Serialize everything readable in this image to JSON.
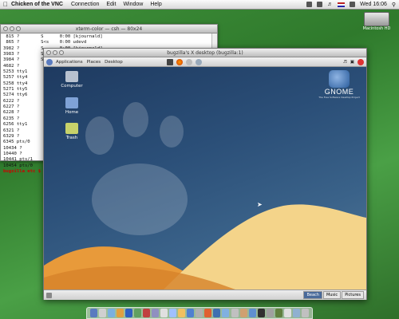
{
  "menubar": {
    "apple": "",
    "app_name": "Chicken of the VNC",
    "items": [
      "Connection",
      "Edit",
      "Window",
      "Help"
    ],
    "clock": "Wed 16:06"
  },
  "desktop_drive": {
    "label": "Macintosh HD"
  },
  "xterm": {
    "title": "xterm-color — csh — 80x24",
    "lines": [
      " 815 ?        S      0:00 [kjournald]",
      " 865 ?        S<s    0:00 udevd",
      "3982 ?        S      0:00 [kjournald]",
      "3983 ?        S      0:00 [kjournald]",
      "3984 ?        S      0:00 [kjournald]",
      "4682 ?",
      "5253 tty1",
      "5257 tty4",
      "5258 tty4",
      "5271 tty5",
      "5274 tty6",
      "6222 ?",
      "6227 ?",
      "6228 ?",
      "6235 ?",
      "6256 tty1",
      "6321 ?",
      "6329 ?",
      "6345 pts/0",
      "10434 ?",
      "10440 ?",
      "10441 pts/1",
      "10454 pts/0"
    ],
    "prompt": "bugzilla etc $"
  },
  "vnc": {
    "title": "bugzilla's X desktop (bugzilla:1)",
    "panel": {
      "applications": "Applications",
      "places": "Places",
      "desktop": "Desktop"
    },
    "desktop_icons": [
      {
        "label": "Computer",
        "color": "#b8c2d0"
      },
      {
        "label": "Home",
        "color": "#7fa2d6"
      },
      {
        "label": "Trash",
        "color": "#c7d26a"
      }
    ],
    "gnome": {
      "logo_text": "GNOME",
      "tagline": "The Free Software Desktop Project"
    },
    "workspaces": [
      "Beach",
      "Music",
      "Pictures"
    ]
  },
  "colors": {
    "xterm_prompt": "#cc0000",
    "gnome_sky": "#2b4f78",
    "dune_light": "#f4d48a",
    "dune_orange": "#e89a3a"
  },
  "dock": {
    "icon_colors": [
      "#5a7bbf",
      "#d0d0d0",
      "#7ab0e0",
      "#e0a040",
      "#3060c0",
      "#60a060",
      "#c04040",
      "#9090c0",
      "#e0e0e0",
      "#a0c0ff",
      "#f0c060",
      "#5080d0",
      "#b0b0b0",
      "#e06030",
      "#4070b0",
      "#80b0e0",
      "#c0c0c0",
      "#d0a070",
      "#6090d0",
      "#303030",
      "#a0a0a0",
      "#608040",
      "#e0e0e0",
      "#90b0d0",
      "#c0c0c0"
    ]
  }
}
